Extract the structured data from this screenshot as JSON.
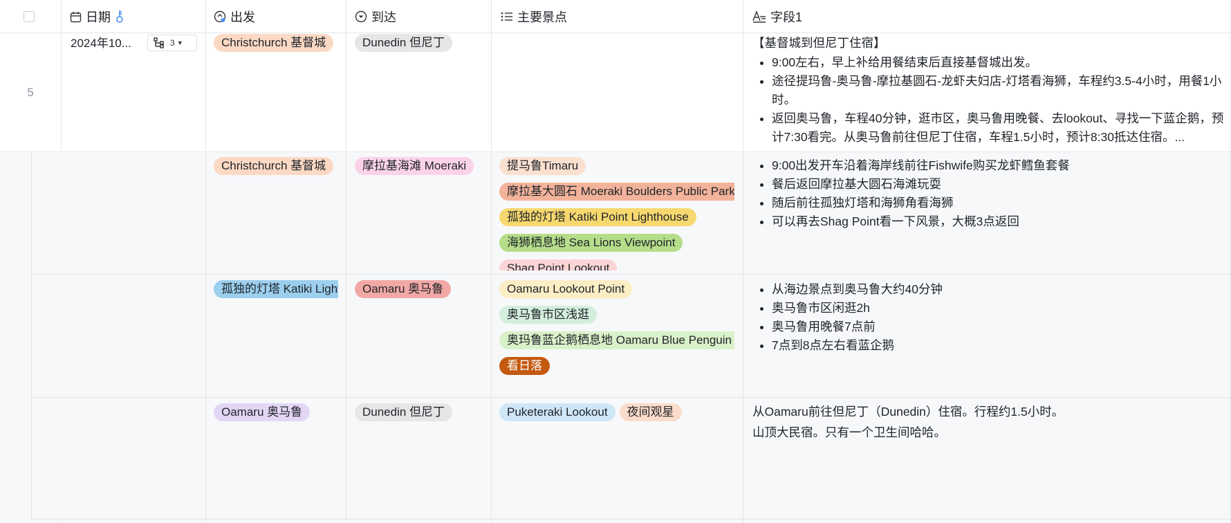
{
  "columns": {
    "date": "日期",
    "from": "出发",
    "to": "到达",
    "spots": "主要景点",
    "field1": "字段1"
  },
  "rows": [
    {
      "row_number": "5",
      "date": "2024年10...",
      "subcount": "3",
      "from": {
        "label": "Christchurch 基督城",
        "color": "#fbd9c4"
      },
      "to": {
        "label": "Dunedin 但尼丁",
        "color": "#e6e6e6"
      },
      "field1_title": "【基督城到但尼丁住宿】",
      "field1_items": [
        "9:00左右，早上补给用餐结束后直接基督城出发。",
        "途径提玛鲁-奥马鲁-摩拉基圆石-龙虾夫妇店-灯塔看海狮，车程约3.5-4小时，用餐1小时。",
        "返回奥马鲁，车程40分钟，逛市区，奥马鲁用晚餐、去lookout、寻找一下蓝企鹅，预计7:30看完。从奥马鲁前往但尼丁住宿，车程1.5小时，预计8:30抵达住宿。..."
      ]
    },
    {
      "from": {
        "label": "Christchurch 基督城",
        "color": "#fbd9c4"
      },
      "to": {
        "label": "摩拉基海滩 Moeraki",
        "color": "#fbd3e9"
      },
      "spots": [
        {
          "label": "提马鲁Timaru",
          "color": "#fbe0d0"
        },
        {
          "label": "摩拉基大圆石 Moeraki Boulders Public Parking",
          "color": "#f2b39a"
        },
        {
          "label": "孤独的灯塔 Katiki Point Lighthouse",
          "color": "#f7d86e"
        },
        {
          "label": "海狮栖息地 Sea Lions Viewpoint",
          "color": "#b5dd8a"
        },
        {
          "label": "Shag Point Lookout",
          "color": "#fbd5d5"
        }
      ],
      "field1_items": [
        "9:00出发开车沿着海岸线前往Fishwife购买龙虾鳕鱼套餐",
        "餐后返回摩拉基大圆石海滩玩耍",
        "随后前往孤独灯塔和海狮角看海狮",
        "可以再去Shag Point看一下风景，大概3点返回"
      ]
    },
    {
      "from": {
        "label": "孤独的灯塔 Katiki Lighthouse",
        "color": "#9ccfee"
      },
      "to": {
        "label": "Oamaru 奥马鲁",
        "color": "#f2a9a6"
      },
      "spots": [
        {
          "label": "Oamaru Lookout Point",
          "color": "#fbedc4",
          "text_color": "#1f2329"
        },
        {
          "label": "奥马鲁市区浅逛",
          "color": "#d4eedd",
          "text_color": "#1f2329"
        },
        {
          "label": "奥玛鲁蓝企鹅栖息地 Oamaru Blue Penguin Colony",
          "color": "#d9f1c9",
          "text_color": "#1f2329"
        },
        {
          "label": "看日落",
          "color": "#c45a10",
          "text_color": "#ffffff"
        }
      ],
      "field1_items": [
        "从海边景点到奥马鲁大约40分钟",
        "奥马鲁市区闲逛2h",
        "奥马鲁用晚餐7点前",
        "7点到8点左右看蓝企鹅"
      ]
    },
    {
      "from": {
        "label": "Oamaru 奥马鲁",
        "color": "#e2d6f5"
      },
      "to": {
        "label": "Dunedin 但尼丁",
        "color": "#e6e6e6"
      },
      "spots": [
        {
          "label": "Puketeraki Lookout",
          "color": "#cfe6f7"
        },
        {
          "label": "夜间观星",
          "color": "#fbdccb"
        }
      ],
      "field1_lines": [
        "从Oamaru前往但尼丁（Dunedin）住宿。行程约1.5小时。",
        "山顶大民宿。只有一个卫生间哈哈。"
      ]
    }
  ]
}
